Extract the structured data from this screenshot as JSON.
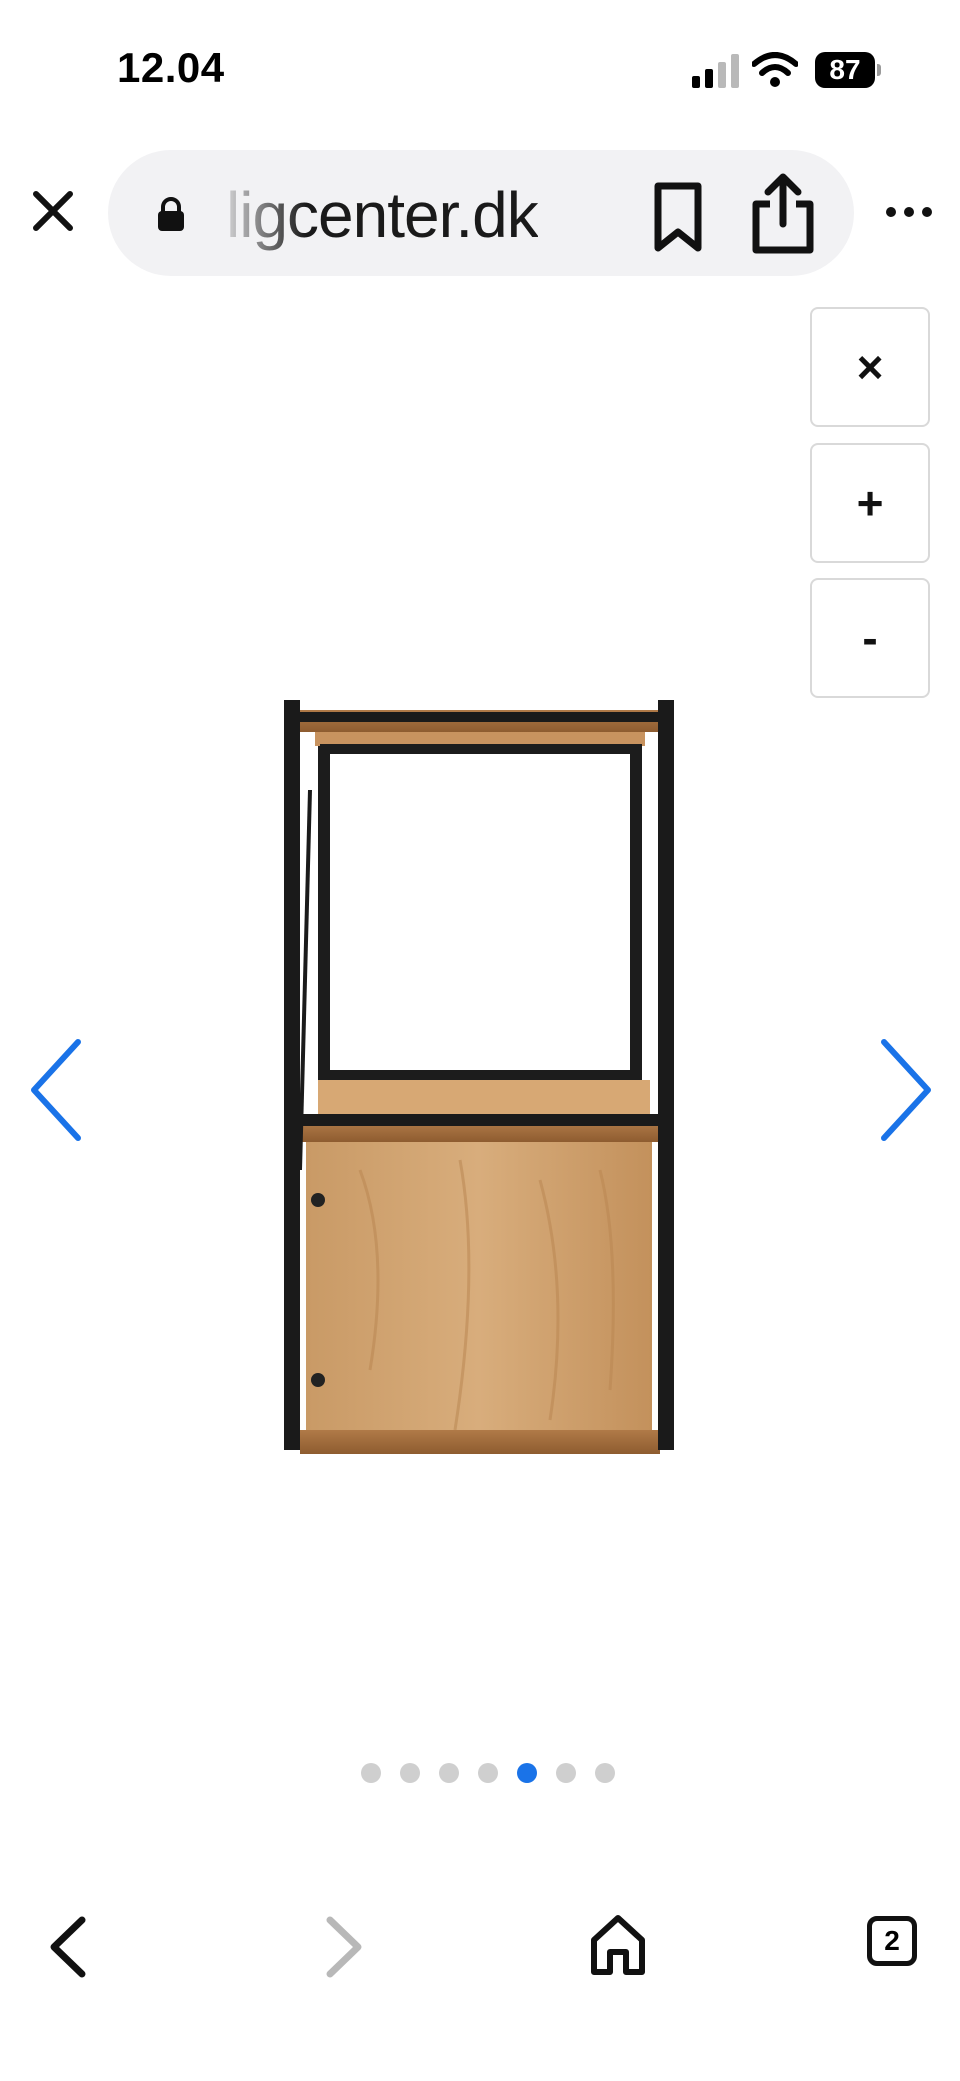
{
  "status_bar": {
    "time": "12.04",
    "battery_percent": "87",
    "signal_icon": "cellular-signal-icon",
    "wifi_icon": "wifi-icon"
  },
  "browser": {
    "url": "ligcenter.dk",
    "close_icon": "close-icon",
    "lock_icon": "lock-icon",
    "bookmark_icon": "bookmark-icon",
    "share_icon": "share-icon",
    "more_icon": "more-options-icon"
  },
  "zoom_controls": {
    "close_label": "×",
    "zoom_in_label": "+",
    "zoom_out_label": "-"
  },
  "gallery": {
    "image_subject": "side view of wooden shelf with black metal frame",
    "prev_icon": "chevron-left-icon",
    "next_icon": "chevron-right-icon",
    "total_images": 7,
    "active_index": 4,
    "accent_color": "#1a73e8"
  },
  "toolbar": {
    "back_icon": "back-icon",
    "forward_icon": "forward-icon",
    "home_icon": "home-icon",
    "tab_count": "2"
  }
}
